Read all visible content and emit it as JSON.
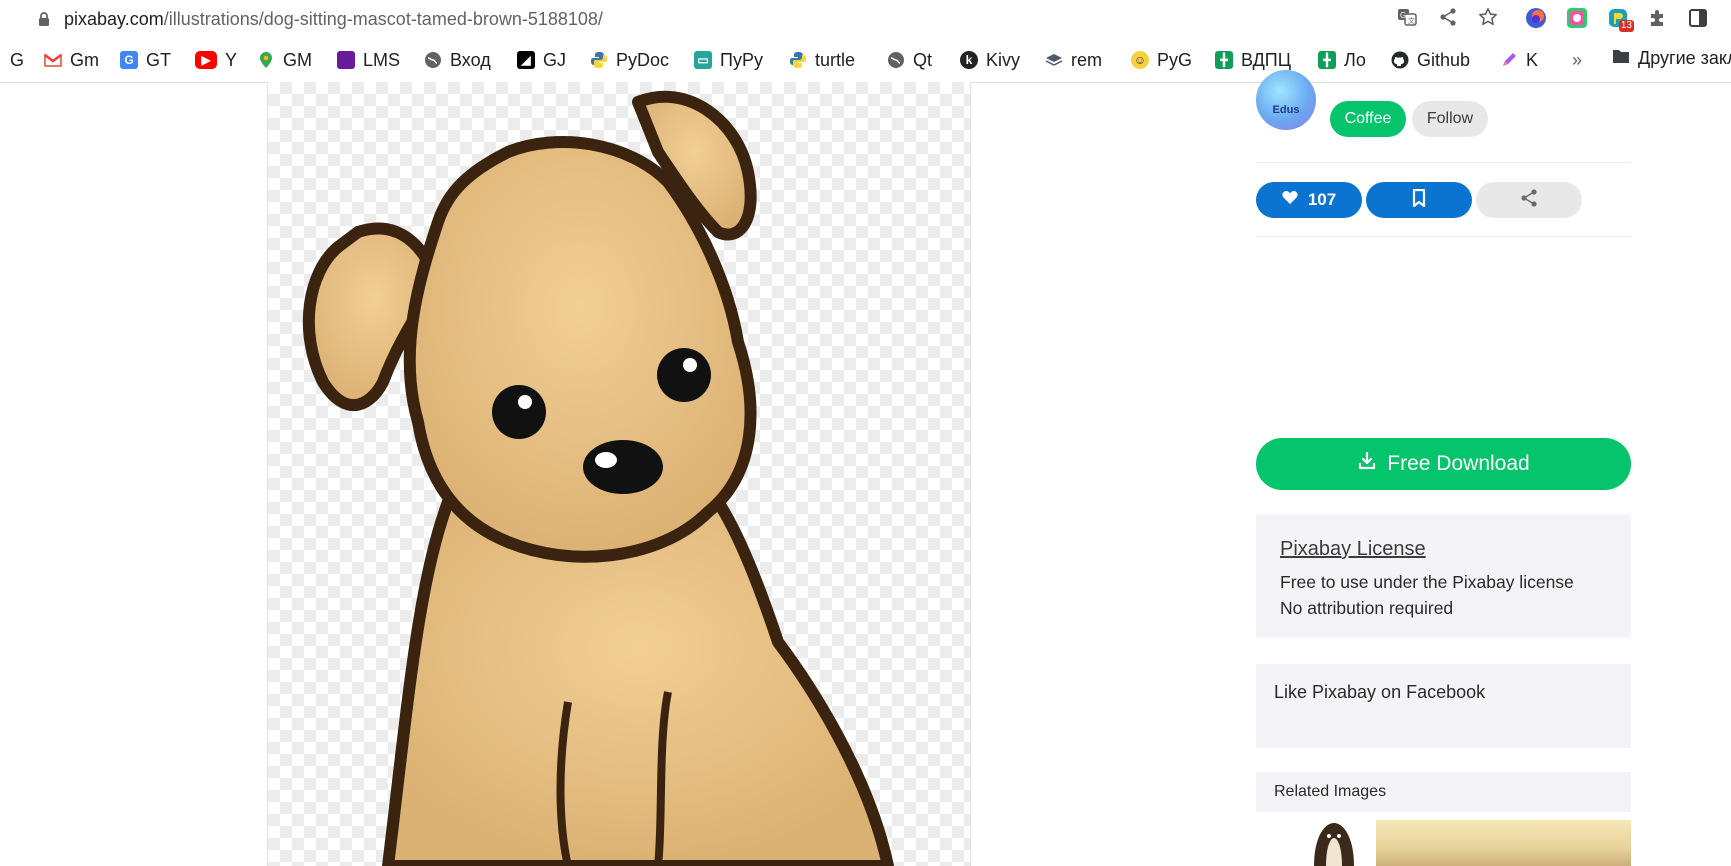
{
  "browser": {
    "url_host": "pixabay.com",
    "url_path": "/illustrations/dog-sitting-mascot-tamed-brown-5188108/",
    "extension_badge": "13"
  },
  "bookmarks": [
    {
      "label": "G",
      "icon": "google-icon"
    },
    {
      "label": "Gm",
      "icon": "gmail-icon"
    },
    {
      "label": "GT",
      "icon": "google-translate-icon"
    },
    {
      "label": "Y",
      "icon": "youtube-icon"
    },
    {
      "label": "GM",
      "icon": "google-maps-icon"
    },
    {
      "label": "LMS",
      "icon": "lms-icon"
    },
    {
      "label": "Вход",
      "icon": "globe-icon"
    },
    {
      "label": "GJ",
      "icon": "gj-icon"
    },
    {
      "label": "PyDoc",
      "icon": "python-icon"
    },
    {
      "label": "ПуРу",
      "icon": "pypy-icon"
    },
    {
      "label": "turtle",
      "icon": "python-icon"
    },
    {
      "label": "Qt",
      "icon": "globe-icon"
    },
    {
      "label": "Kivy",
      "icon": "kivy-icon"
    },
    {
      "label": "rem",
      "icon": "layers-icon"
    },
    {
      "label": "PyG",
      "icon": "pygame-icon"
    },
    {
      "label": "ВДПЦ",
      "icon": "sheets-icon"
    },
    {
      "label": "Ло",
      "icon": "sheets-icon"
    },
    {
      "label": "Github",
      "icon": "github-icon"
    },
    {
      "label": "K",
      "icon": "pen-icon"
    }
  ],
  "bookmarks_more": "»",
  "other_bookmarks": "Другие закладки",
  "sidebar": {
    "avatar_text": "Edus",
    "coffee_label": "Coffee",
    "follow_label": "Follow",
    "like_count": "107",
    "download_label": "Free Download",
    "license_title": "Pixabay License",
    "license_line1": "Free to use under the Pixabay license",
    "license_line2": "No attribution required",
    "facebook_text": "Like Pixabay on Facebook",
    "related_title": "Related Images"
  },
  "colors": {
    "accent_green": "#05c46b",
    "accent_blue": "#0b74d1",
    "dog_fur": "#e9c48b",
    "dog_outline": "#3a2410"
  }
}
